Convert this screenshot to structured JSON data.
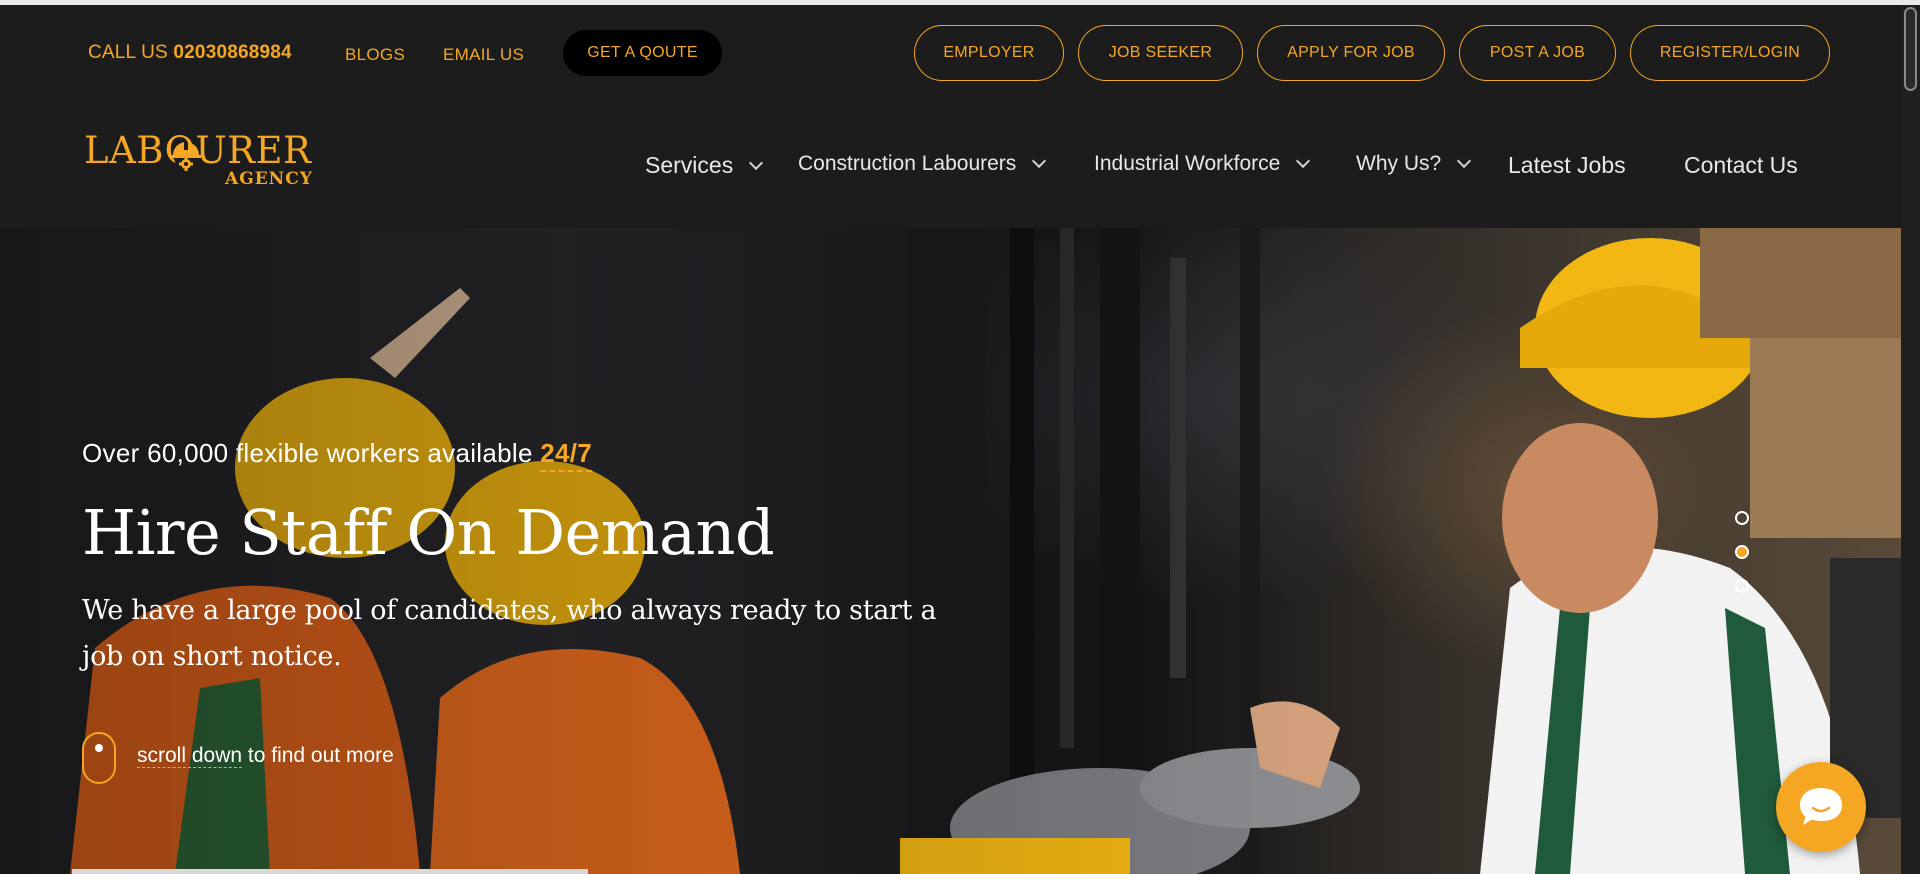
{
  "topbar": {
    "call_label": "CALL US",
    "phone": "02030868984",
    "links": [
      "BLOGS",
      "EMAIL US"
    ],
    "quote_button": "GET A QOUTE",
    "pills": [
      "EMPLOYER",
      "JOB SEEKER",
      "APPLY FOR JOB",
      "POST A JOB",
      "REGISTER/LOGIN"
    ]
  },
  "logo": {
    "text": "LABOURER",
    "sub": "AGENCY"
  },
  "nav": [
    {
      "label": "Services",
      "dropdown": true
    },
    {
      "label": "Construction Labourers",
      "dropdown": true
    },
    {
      "label": "Industrial Workforce",
      "dropdown": true
    },
    {
      "label": "Why Us?",
      "dropdown": true
    },
    {
      "label": "Latest Jobs",
      "dropdown": false
    },
    {
      "label": "Contact Us",
      "dropdown": false
    }
  ],
  "hero": {
    "tagline": "Over 60,000 flexible workers available",
    "tagline_highlight": "24/7",
    "headline": "Hire Staff On Demand",
    "subline": "We have a large pool of candidates, who always ready to start a job on short notice.",
    "scroll_link": "scroll down",
    "scroll_rest": "to find out more",
    "slider_dots": 3,
    "active_slide": 2
  },
  "colors": {
    "accent": "#f5a623",
    "background": "#1c1c1c",
    "text": "#ffffff"
  },
  "icons": [
    "helmet-gear-icon",
    "chevron-down-icon",
    "chat-bubble-icon",
    "mouse-scroll-icon"
  ]
}
